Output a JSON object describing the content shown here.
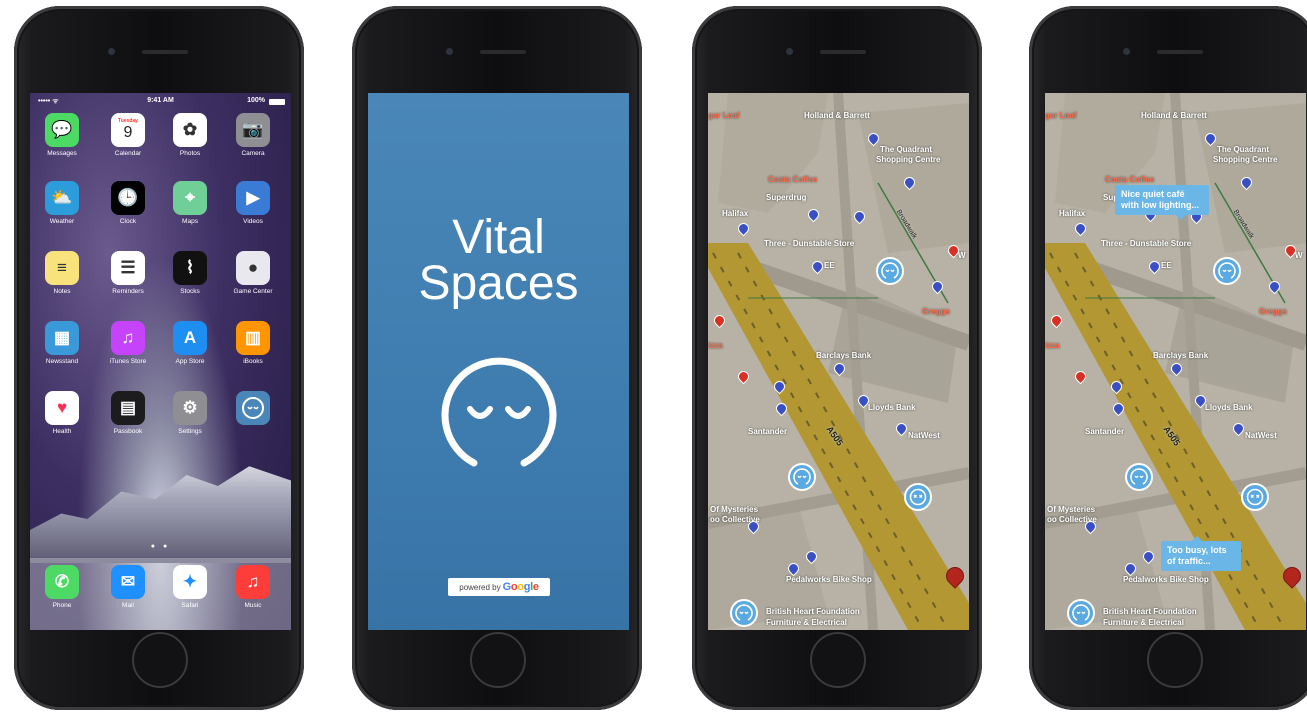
{
  "phone1": {
    "status": {
      "signal": "••••• ᯤ",
      "time": "9:41 AM",
      "battery": "100%"
    },
    "apps": [
      {
        "label": "Messages",
        "icon": "message-icon",
        "color": "#4cd964",
        "glyph": "💬"
      },
      {
        "label": "Calendar",
        "icon": "calendar-icon",
        "color": "#ffffff",
        "glyph": "9",
        "sub": "Tuesday"
      },
      {
        "label": "Photos",
        "icon": "photos-icon",
        "color": "#ffffff",
        "glyph": "✿"
      },
      {
        "label": "Camera",
        "icon": "camera-icon",
        "color": "#8e8e93",
        "glyph": "📷"
      },
      {
        "label": "Weather",
        "icon": "weather-icon",
        "color": "#2d9cdb",
        "glyph": "⛅"
      },
      {
        "label": "Clock",
        "icon": "clock-icon",
        "color": "#000000",
        "glyph": "🕒"
      },
      {
        "label": "Maps",
        "icon": "maps-icon",
        "color": "#6fcf97",
        "glyph": "⌖"
      },
      {
        "label": "Videos",
        "icon": "videos-icon",
        "color": "#3a7bd5",
        "glyph": "▶"
      },
      {
        "label": "Notes",
        "icon": "notes-icon",
        "color": "#f7e27b",
        "glyph": "≡"
      },
      {
        "label": "Reminders",
        "icon": "reminders-icon",
        "color": "#ffffff",
        "glyph": "☰"
      },
      {
        "label": "Stocks",
        "icon": "stocks-icon",
        "color": "#111111",
        "glyph": "⌇"
      },
      {
        "label": "Game Center",
        "icon": "game-center-icon",
        "color": "#e8e8ee",
        "glyph": "●"
      },
      {
        "label": "Newsstand",
        "icon": "newsstand-icon",
        "color": "#3a9ad9",
        "glyph": "▦"
      },
      {
        "label": "iTunes Store",
        "icon": "itunes-icon",
        "color": "#c643fc",
        "glyph": "♫"
      },
      {
        "label": "App Store",
        "icon": "app-store-icon",
        "color": "#1f8ef1",
        "glyph": "A"
      },
      {
        "label": "iBooks",
        "icon": "ibooks-icon",
        "color": "#ff9500",
        "glyph": "▥"
      },
      {
        "label": "Health",
        "icon": "health-icon",
        "color": "#ffffff",
        "glyph": "♥"
      },
      {
        "label": "Passbook",
        "icon": "passbook-icon",
        "color": "#1c1c1e",
        "glyph": "▤"
      },
      {
        "label": "Settings",
        "icon": "settings-icon",
        "color": "#8e8e93",
        "glyph": "⚙"
      },
      {
        "label": "",
        "icon": "vital-spaces-app-icon",
        "color": "#4a87b8",
        "glyph": "ᵕᵕ"
      }
    ],
    "dock": [
      {
        "label": "Phone",
        "icon": "phone-icon",
        "color": "#4cd964",
        "glyph": "✆"
      },
      {
        "label": "Mail",
        "icon": "mail-icon",
        "color": "#1e90ff",
        "glyph": "✉"
      },
      {
        "label": "Safari",
        "icon": "safari-icon",
        "color": "#ffffff",
        "glyph": "✦"
      },
      {
        "label": "Music",
        "icon": "music-icon",
        "color": "#fc3d39",
        "glyph": "♫"
      }
    ]
  },
  "phone2": {
    "title_line1": "Vital",
    "title_line2": "Spaces",
    "powered_by": "powered by",
    "google": "Google"
  },
  "map": {
    "places": {
      "sugar_loaf": "gar Loaf",
      "holland": "Holland & Barrett",
      "quadrant1": "The Quadrant",
      "quadrant2": "Shopping Centre",
      "costa": "Costa Coffee",
      "superdrug": "Superdrug",
      "halifax": "Halifax",
      "three": "Three - Dunstable Store",
      "ee": "EE",
      "greggs": "Greggs",
      "pizza": "izza",
      "barclays": "Barclays Bank",
      "lloyds": "Lloyds Bank",
      "natwest": "NatWest",
      "santander": "Santander",
      "road": "A505",
      "broadwalk": "Broadwalk",
      "mysteries1": "Of Mysteries",
      "mysteries2": "oo Collective",
      "pedalworks": "Pedalworks Bike Shop",
      "bhf1": "British Heart Foundation",
      "bhf2": "Furniture & Electrical",
      "w": "W"
    },
    "bubble_good": "Nice quiet café with low lighting...",
    "bubble_bad": "Too busy, lots of traffic..."
  }
}
